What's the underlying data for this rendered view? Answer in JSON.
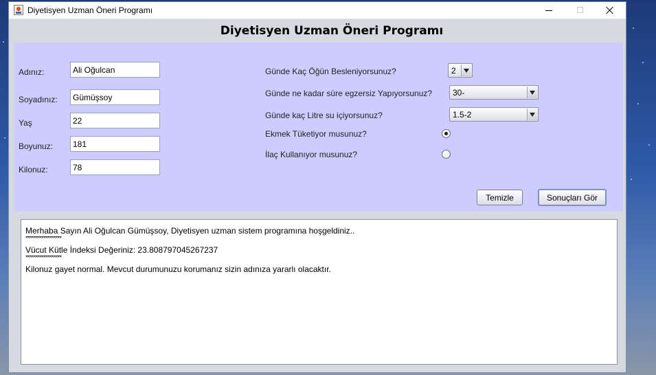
{
  "window": {
    "title": "Diyetisyen Uzman Öneri Programı"
  },
  "header": {
    "title": "Diyetisyen Uzman Öneri Programı"
  },
  "personal": {
    "name_label": "Adınız:",
    "name_value": "Ali Oğulcan",
    "surname_label": "Soyadınız:",
    "surname_value": "Gümüşsoy",
    "age_label": "Yaş",
    "age_value": "22",
    "height_label": "Boyunuz:",
    "height_value": "181",
    "weight_label": "Kilonuz:",
    "weight_value": "78"
  },
  "habits": {
    "meals_label": "Günde Kaç Öğün Besleniyorsunuz?",
    "meals_value": "2",
    "exercise_label": "Günde ne kadar süre egzersiz Yapıyorsunuz?",
    "exercise_value": "30-",
    "water_label": "Günde kaç Litre su içiyorsunuz?",
    "water_value": "1.5-2",
    "bread_label": "Ekmek Tüketiyor musunuz?",
    "bread_checked": true,
    "medicine_label": "İlaç Kullanıyor musunuz?",
    "medicine_checked": false
  },
  "buttons": {
    "clear_label": "Temizle",
    "results_label": "Sonuçları Gör"
  },
  "output": {
    "line1": "Merhaba Sayın Ali Oğulcan Gümüşsoy, Diyetisyen uzman sistem programına hoşgeldiniz..",
    "sep1": "******************",
    "line2": "Vücut Kütle İndeksi Değeriniz: 23.808797045267237",
    "sep2": "******************",
    "line3": "Kilonuz gayet normal. Mevcut durumunuzu korumanız sizin adınıza yararlı olacaktır."
  }
}
